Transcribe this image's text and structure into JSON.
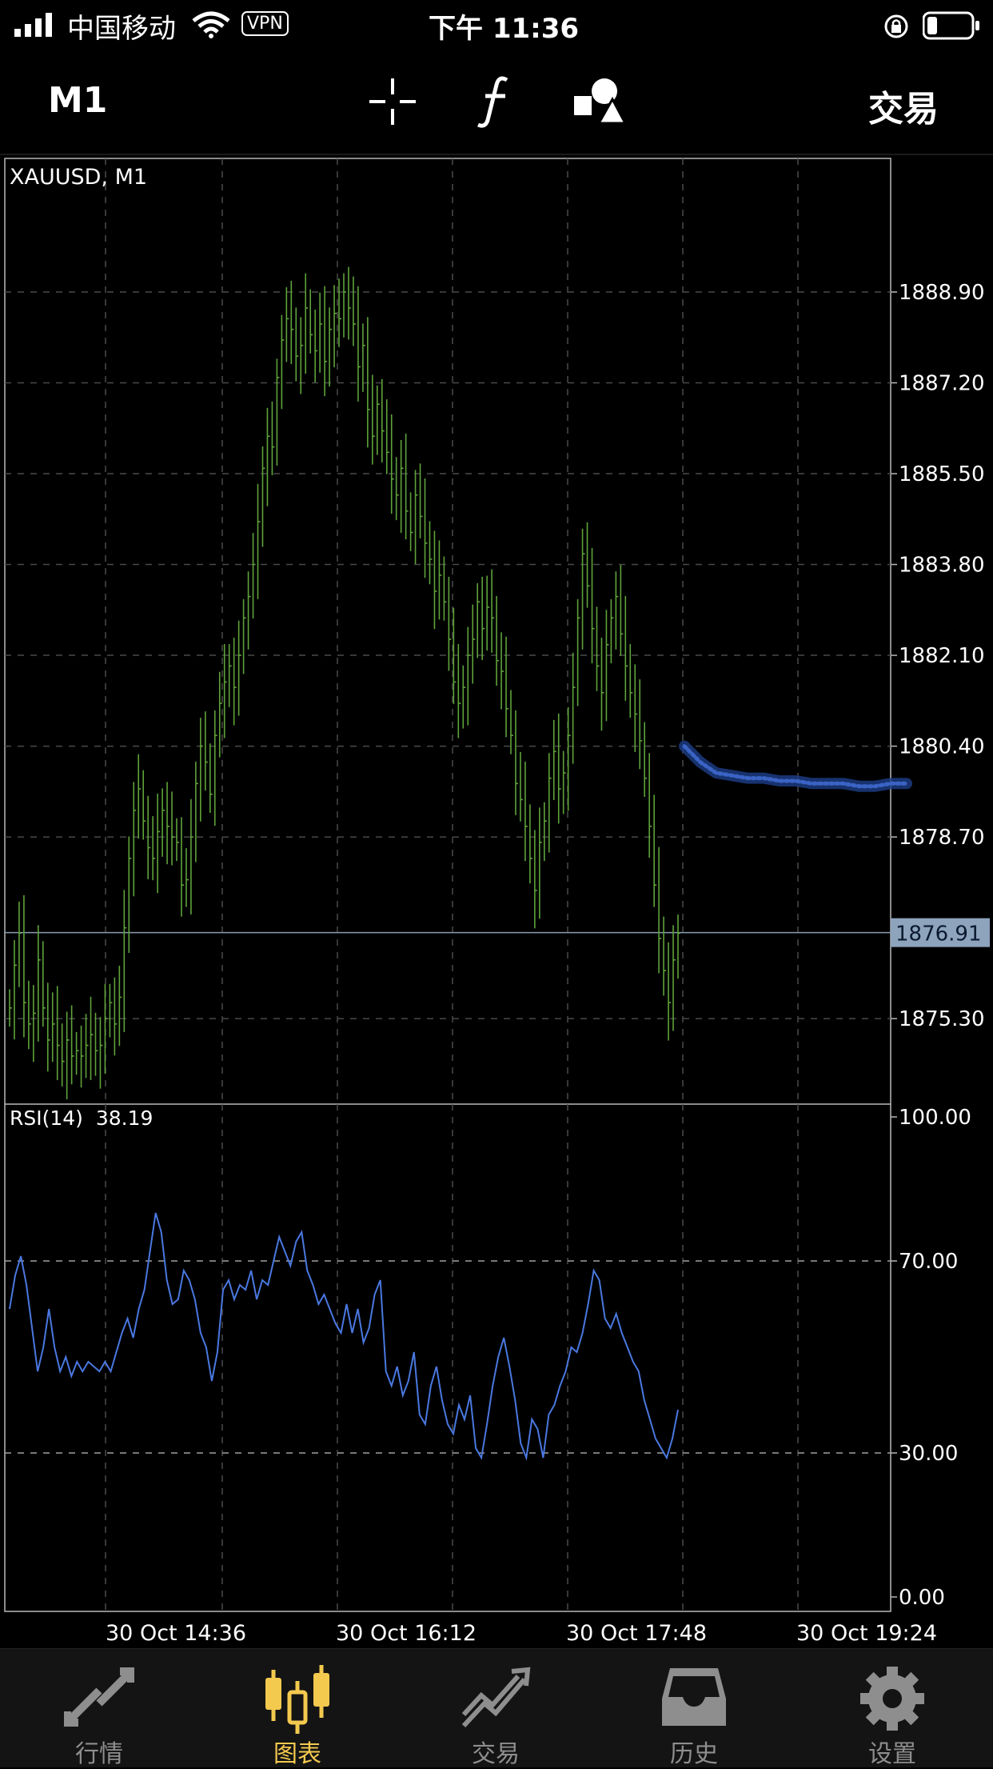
{
  "status_bar": {
    "carrier": "中国移动",
    "vpn": "VPN",
    "time": "下午 11:36"
  },
  "toolbar": {
    "timeframe": "M1",
    "trade_label": "交易"
  },
  "chart_data": [
    {
      "type": "bar",
      "title": "XAUUSD, M1",
      "ylim": [
        1873.7,
        1891.4
      ],
      "y_ticks": [
        "1888.90",
        "1887.20",
        "1885.50",
        "1883.80",
        "1882.10",
        "1880.40",
        "1878.70",
        "1875.30"
      ],
      "current_price": "1876.91",
      "x_ticks": [
        "30 Oct 14:36",
        "30 Oct 16:12",
        "30 Oct 17:48",
        "30 Oct 19:24"
      ],
      "grid": true,
      "series": [
        {
          "close": [
            1875.5,
            1876.3,
            1876.9,
            1875.6,
            1875.2,
            1875.4,
            1876.4,
            1875.5,
            1874.9,
            1875.2,
            1874.8,
            1874.5,
            1874.9,
            1874.6,
            1874.7,
            1874.6,
            1874.8,
            1875.0,
            1874.7,
            1874.8,
            1875.3,
            1875.6,
            1875.2,
            1875.7,
            1877.0,
            1878.3,
            1879.2,
            1879.6,
            1879.0,
            1878.5,
            1878.3,
            1878.8,
            1879.2,
            1878.9,
            1878.7,
            1878.6,
            1877.8,
            1877.9,
            1878.7,
            1879.7,
            1880.4,
            1880.1,
            1879.5,
            1880.6,
            1881.2,
            1881.6,
            1881.9,
            1881.5,
            1882.1,
            1882.8,
            1883.2,
            1883.8,
            1884.6,
            1885.6,
            1886.2,
            1886.0,
            1887.3,
            1888.0,
            1888.4,
            1888.2,
            1887.7,
            1887.9,
            1888.6,
            1888.1,
            1887.8,
            1888.3,
            1887.6,
            1888.2,
            1888.5,
            1888.4,
            1888.9,
            1888.6,
            1888.3,
            1887.5,
            1887.9,
            1886.7,
            1886.2,
            1886.8,
            1886.3,
            1885.9,
            1885.4,
            1885.1,
            1885.6,
            1884.8,
            1884.4,
            1885.1,
            1884.7,
            1884.2,
            1883.9,
            1883.3,
            1883.6,
            1883.1,
            1882.4,
            1881.6,
            1881.2,
            1881.5,
            1882.1,
            1882.4,
            1883.1,
            1882.6,
            1883.0,
            1882.8,
            1882.0,
            1881.8,
            1881.1,
            1880.6,
            1879.7,
            1879.4,
            1878.9,
            1878.3,
            1877.7,
            1878.6,
            1879.0,
            1879.8,
            1880.3,
            1879.6,
            1879.9,
            1880.6,
            1881.5,
            1882.8,
            1884.0,
            1883.4,
            1882.6,
            1881.9,
            1881.4,
            1882.3,
            1882.8,
            1883.2,
            1882.5,
            1881.9,
            1881.4,
            1881.0,
            1880.5,
            1879.8,
            1878.9,
            1877.8,
            1876.8,
            1876.2,
            1875.6,
            1876.4,
            1876.9
          ],
          "forecast": [
            1880.4,
            1880.1,
            1879.9,
            1879.85,
            1879.8,
            1879.8,
            1879.75,
            1879.75,
            1879.7,
            1879.7,
            1879.7,
            1879.65,
            1879.65,
            1879.7,
            1879.7
          ]
        }
      ]
    },
    {
      "type": "line",
      "title": "RSI(14)  38.19",
      "ylim": [
        0,
        100
      ],
      "y_ticks": [
        "100.00",
        "70.00",
        "30.00",
        "0.00"
      ],
      "x_ticks": [
        "30 Oct 14:36",
        "30 Oct 16:12",
        "30 Oct 17:48",
        "30 Oct 19:24"
      ],
      "levels": [
        70,
        30
      ],
      "series": [
        {
          "values": [
            60,
            67,
            71,
            65,
            56,
            47,
            52,
            60,
            52,
            47,
            50,
            46,
            49,
            47,
            49,
            48,
            47,
            49,
            47,
            51,
            55,
            58,
            54,
            60,
            64,
            72,
            80,
            76,
            66,
            61,
            62,
            68,
            66,
            62,
            55,
            52,
            45,
            51,
            64,
            66,
            62,
            65,
            64,
            68,
            62,
            66,
            65,
            70,
            75,
            72,
            69,
            74,
            76,
            68,
            65,
            61,
            63,
            60,
            57,
            55,
            61,
            55,
            60,
            53,
            56,
            63,
            66,
            47,
            44,
            48,
            42,
            45,
            51,
            38,
            36,
            44,
            48,
            41,
            36,
            34,
            40,
            37,
            42,
            31,
            29,
            36,
            44,
            50,
            54,
            48,
            41,
            32,
            29,
            37,
            35,
            29,
            38,
            40,
            44,
            47,
            52,
            51,
            55,
            61,
            68,
            66,
            58,
            56,
            59,
            55,
            52,
            49,
            47,
            41,
            37,
            33,
            31,
            29,
            33,
            39
          ]
        }
      ]
    }
  ],
  "tabs": [
    {
      "label": "行情"
    },
    {
      "label": "图表"
    },
    {
      "label": "交易"
    },
    {
      "label": "历史"
    },
    {
      "label": "设置"
    }
  ]
}
